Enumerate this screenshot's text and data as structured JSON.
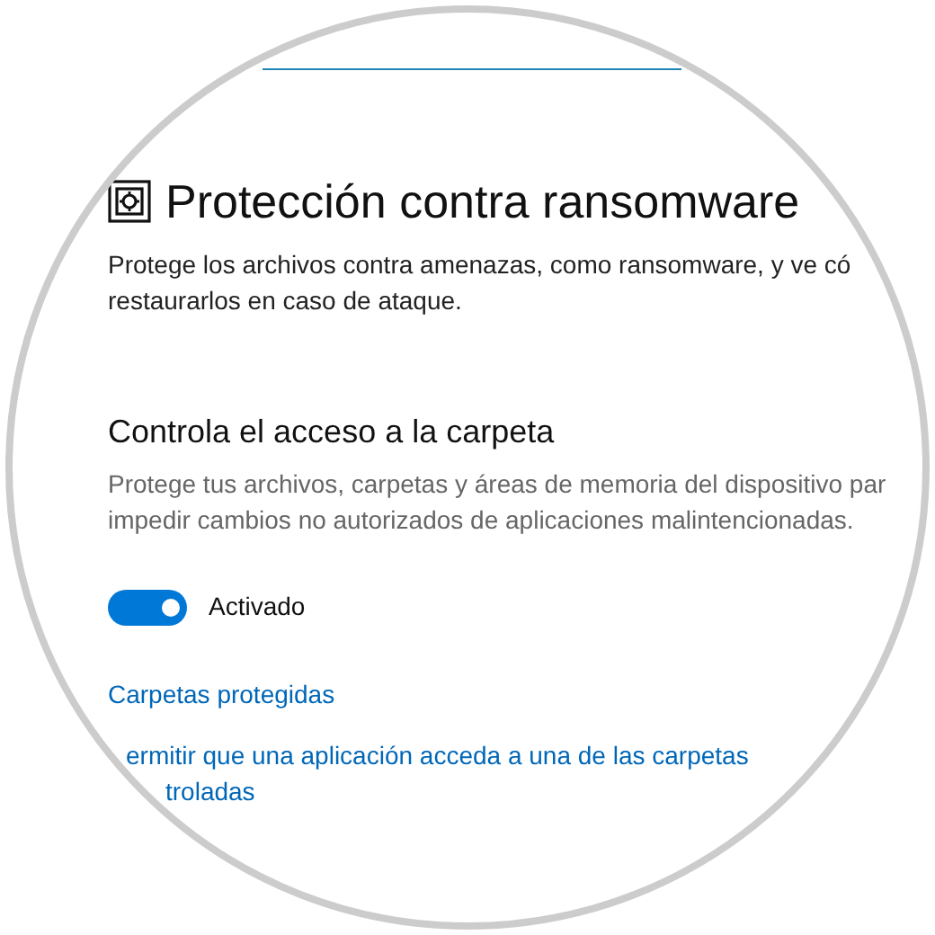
{
  "page": {
    "title": "Protección contra ransomware",
    "description": [
      "Protege los archivos contra amenazas, como ransomware, y ve có",
      "restaurarlos en caso de ataque."
    ]
  },
  "section": {
    "heading": "Controla el acceso a la carpeta",
    "description": [
      "Protege tus archivos, carpetas y áreas de memoria del dispositivo par",
      "impedir cambios no autorizados de aplicaciones malintencionadas."
    ],
    "toggle": {
      "on": true,
      "label": "Activado"
    },
    "links": [
      {
        "lines": [
          "Carpetas protegidas"
        ]
      },
      {
        "lines": [
          "ermitir que una aplicación acceda a una de las carpetas",
          "troladas"
        ]
      }
    ]
  }
}
